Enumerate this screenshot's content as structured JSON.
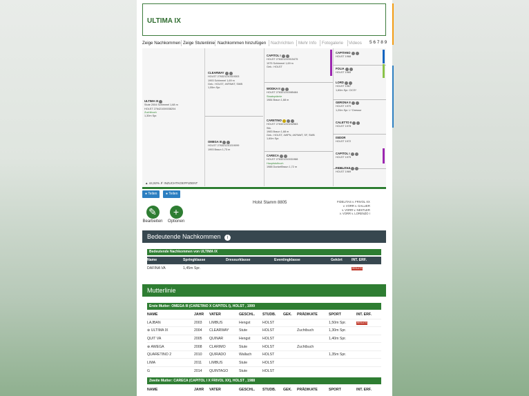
{
  "horse": {
    "name": "ULTIMA IX"
  },
  "tabs": [
    {
      "label": "Zeige Nachkommen",
      "active": true
    },
    {
      "label": "Zeige Stutenlinie",
      "active": true
    },
    {
      "label": "Nachkommen hinzufügen",
      "active": true
    },
    {
      "label": "Nachrichten",
      "active": false
    },
    {
      "label": "Mehr Info",
      "active": false
    },
    {
      "label": "Fotogalerie",
      "active": false
    },
    {
      "label": "Videos",
      "active": false
    }
  ],
  "pages": "5 6 7 8 9",
  "pedigree": {
    "subject": {
      "name": "ULTIMA IX",
      "l1": "Stute 2004 Schimmel 1,68 m",
      "l2": "HOLST 276421000038204",
      "l3": "Zuchtbuch",
      "l4": "1,30m Spr."
    },
    "sire": {
      "name": "CLEARWAY",
      "l1": "HOLST 276321210319303",
      "l2": "1993 Schimmel 1,69 m",
      "l3": "Gek.: HOLST, 4KPAWT, SWB",
      "l4": "1,55m Spr."
    },
    "dam": {
      "name": "OMEGA III",
      "l1": "HOLST 276321210219099",
      "l2": "1993 Braun 1,73 m"
    },
    "ss": {
      "name": "CAPITOL I",
      "l1": "HOLST 276321210015475",
      "l2": "1975 Schimmel 1,69 m",
      "l3": "Gek.: HOLST"
    },
    "sd": {
      "name": "WODKA II",
      "l1": "HOLST 276321210085484",
      "l2": "Staatsprämie",
      "l3": "1984 Braun 1,68 m"
    },
    "ds": {
      "name": "CARETINO",
      "l1": "HOLST 276321210242583",
      "l2": "Stb.",
      "l3": "1983 Braun 1,68 m",
      "l4": "Gek.: HOLST, 4WPN, 4KPAWT, SF, SWB",
      "l5": "1,60m Spr."
    },
    "dd": {
      "name": "CARECA",
      "l1": "HOLST 276321210031988",
      "l2": "Hauptstutbuch",
      "l3": "1988 DunkelBraun 1,72 m"
    },
    "g": [
      {
        "name": "CAPITANO",
        "l1": "HOLST 1968"
      },
      {
        "name": "FOLIA",
        "l1": "HOLST 1969"
      },
      {
        "name": "LORD",
        "l1": "HOLST 1967",
        "l2": "1,60m Spr. CICS*"
      },
      {
        "name": "GERONA II",
        "l1": "HOLST 1970",
        "l2": "1,20m Spr. L* Dressur"
      },
      {
        "name": "CALETTO II",
        "l1": "HOLST 1978"
      },
      {
        "name": "ISIDOR",
        "l1": "HOLST 1972"
      },
      {
        "name": "CAPITOL I",
        "l1": "HOLST 1975"
      },
      {
        "name": "FIDELITAS",
        "l1": "HOLST 1969"
      }
    ],
    "inbreeding_pct": "44,92%",
    "inbreeding_label": "INZUCHTKOEFFIZIENT"
  },
  "share": {
    "facebook": "Teilen",
    "twitter": "Teilen"
  },
  "stamm": "Holst Stamm 8805",
  "family": [
    "FIDELITAS v. FRIVOL XX",
    "v. VORR v. GALLIER",
    "v. VORR v. NESTLER",
    "v. VORR v. LORENZO I"
  ],
  "actions": {
    "edit": "Bearbeiten",
    "options": "Optionen"
  },
  "offspring": {
    "heading": "Bedeutende Nachkommen",
    "subheading": "Bedeutende Nachkommen von ULTIMA IX",
    "columns": [
      "Name",
      "Springklasse",
      "Dressurklasse",
      "Eventingklasse",
      "Gekört",
      "INT. ERF."
    ],
    "rows": [
      {
        "name": "DAFINA VA",
        "spring": "1,45m Spr.",
        "dressur": "",
        "eventing": "",
        "gekort": "",
        "int": "RESULTS"
      }
    ]
  },
  "mutterlinie": {
    "heading": "Mutterlinie",
    "first_mother": "Erste Mutter: OMEGA III (CARETINO X CAPITOL I), HOLST , 1999",
    "columns": [
      "NAME",
      "JAHR",
      "VATER",
      "GESCHL.",
      "STUDB.",
      "GEK.",
      "PRÄDIKATE",
      "SPORT",
      "INT. ERF."
    ],
    "rows": [
      {
        "name": "LAJBAN",
        "jahr": "2003",
        "vater": "LIMBUS",
        "geschl": "Hengst",
        "studb": "HOLST",
        "gek": "",
        "pradikate": "",
        "sport": "1,50m Spr.",
        "int": "RESULTS"
      },
      {
        "name": "⊕ ULTIMA IX",
        "jahr": "2004",
        "vater": "CLEARWAY",
        "geschl": "Stute",
        "studb": "HOLST",
        "gek": "",
        "pradikate": "Zuchtbuch",
        "sport": "1,30m Spr.",
        "int": ""
      },
      {
        "name": "QUIT VA",
        "jahr": "2005",
        "vater": "QUINAR",
        "geschl": "Hengst",
        "studb": "HOLST",
        "gek": "",
        "pradikate": "",
        "sport": "1,40m Spr.",
        "int": ""
      },
      {
        "name": "⊕ AWEGA",
        "jahr": "2008",
        "vater": "CLARIMO",
        "geschl": "Stute",
        "studb": "HOLST",
        "gek": "",
        "pradikate": "Zuchtbuch",
        "sport": "",
        "int": ""
      },
      {
        "name": "QUARETINO 2",
        "jahr": "2010",
        "vater": "QUIRADO",
        "geschl": "Wallach",
        "studb": "HOLST",
        "gek": "",
        "pradikate": "",
        "sport": "1,35m Spr.",
        "int": ""
      },
      {
        "name": "LIMA",
        "jahr": "2011",
        "vater": "LIMBUS",
        "geschl": "Stute",
        "studb": "HOLST",
        "gek": "",
        "pradikate": "",
        "sport": "",
        "int": ""
      },
      {
        "name": "G",
        "jahr": "2014",
        "vater": "QUINTAGO",
        "geschl": "Stute",
        "studb": "HOLST",
        "gek": "",
        "pradikate": "",
        "sport": "",
        "int": ""
      }
    ],
    "second_mother": "Zweite Mutter: CARECA (CAPITOL I X FRIVOL XX), HOLST , 1988",
    "second_columns": [
      "NAME",
      "JAHR",
      "VATER",
      "GESCHL.",
      "STUDB.",
      "GEK.",
      "PRÄDIKATE",
      "SPORT",
      "INT. ERF."
    ]
  },
  "colors": {
    "green": "#2e7d32",
    "dark_header": "#37474f",
    "facebook": "#2d7fc1",
    "results": "#c0392b"
  }
}
